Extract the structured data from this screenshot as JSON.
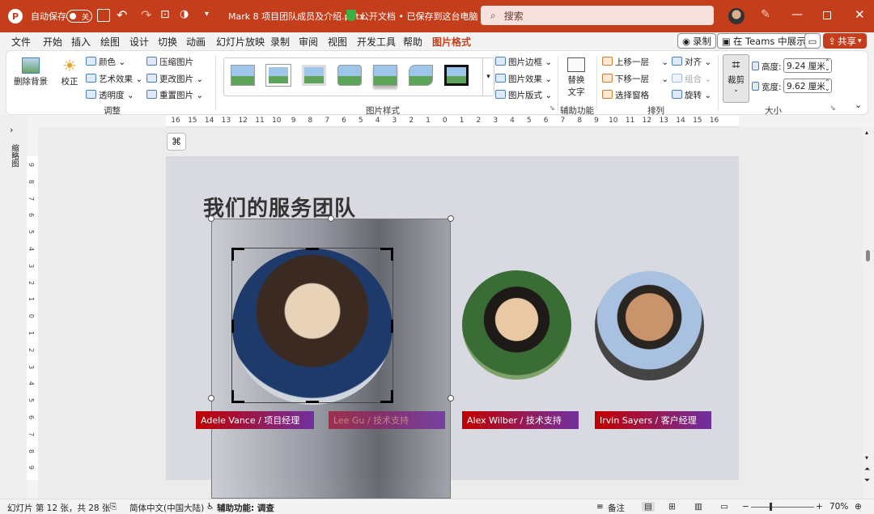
{
  "titlebar": {
    "autosave_label": "自动保存",
    "autosave_state": "关",
    "doc_title": "Mark 8 项目团队成员及介绍.pptx",
    "doc_status": "公开文档 • 已保存到这台电脑",
    "search_placeholder": "搜索"
  },
  "tabs": [
    "文件",
    "开始",
    "插入",
    "绘图",
    "设计",
    "切换",
    "动画",
    "幻灯片放映",
    "录制",
    "审阅",
    "视图",
    "开发工具",
    "帮助",
    "图片格式"
  ],
  "tab_actions": {
    "record": "录制",
    "teams": "在 Teams 中展示",
    "share": "共享"
  },
  "ribbon": {
    "remove_bg": "删除背景",
    "corrections": "校正",
    "color": "颜色",
    "artistic": "艺术效果",
    "transparency": "透明度",
    "compress": "压缩图片",
    "change": "更改图片",
    "reset": "重置图片",
    "group_adjust": "调整",
    "group_styles": "图片样式",
    "border": "图片边框",
    "effects": "图片效果",
    "layout": "图片版式",
    "alt_text_1": "替换",
    "alt_text_2": "文字",
    "group_access": "辅助功能",
    "bring_forward": "上移一层",
    "send_backward": "下移一层",
    "selection_pane": "选择窗格",
    "align": "对齐",
    "group": "组合",
    "rotate": "旋转",
    "group_arrange": "排列",
    "crop": "裁剪",
    "height_label": "高度:",
    "height_value": "9.24 厘米",
    "width_label": "宽度:",
    "width_value": "9.62 厘米",
    "group_size": "大小"
  },
  "left_pane_label": "缩略图",
  "ruler_h": [
    "16",
    "15",
    "14",
    "13",
    "12",
    "11",
    "10",
    "9",
    "8",
    "7",
    "6",
    "5",
    "4",
    "3",
    "2",
    "1",
    "0",
    "1",
    "2",
    "3",
    "4",
    "5",
    "6",
    "7",
    "8",
    "9",
    "10",
    "11",
    "12",
    "13",
    "14",
    "15",
    "16"
  ],
  "ruler_v": [
    "9",
    "8",
    "7",
    "6",
    "5",
    "4",
    "3",
    "2",
    "1",
    "0",
    "1",
    "2",
    "3",
    "4",
    "5",
    "6",
    "7",
    "8",
    "9"
  ],
  "slide": {
    "title": "我们的服务团队",
    "members": [
      {
        "name": "Adele Vance / 项目经理"
      },
      {
        "name": "Lee Gu / 技术支持"
      },
      {
        "name": "Alex Wilber / 技术支持"
      },
      {
        "name": "Irvin Sayers / 客户经理"
      }
    ]
  },
  "status": {
    "slide_info": "幻灯片 第 12 张，共 28 张",
    "language": "简体中文(中国大陆)",
    "accessibility": "辅助功能: 调查",
    "notes": "备注",
    "zoom": "70%"
  },
  "colors": {
    "accent": "#c43e1c",
    "red_bar": "#c00000",
    "purple_bar": "#7030a0"
  }
}
